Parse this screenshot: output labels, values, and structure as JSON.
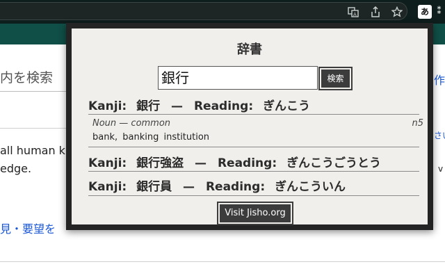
{
  "browser": {
    "icons": [
      "translate-icon",
      "share-icon",
      "bookmark-star-icon",
      "extension-icon"
    ],
    "extension_glyph": "あ"
  },
  "page": {
    "search_placeholder": "内を検索",
    "text_line1": "all human kn",
    "text_line2": "edge.",
    "link_text": "見・要望を",
    "right_frag_top": "作",
    "right_frag_mid": "さい",
    "right_frag_low": "v"
  },
  "popup": {
    "title": "辞書",
    "search_value": "銀行",
    "search_button": "検索",
    "kanji_label": "Kanji:",
    "reading_label": "Reading:",
    "dash": "—",
    "results": [
      {
        "kanji": "銀行",
        "reading": "ぎんこう"
      },
      {
        "kanji": "銀行強盗",
        "reading": "ぎんこうごうとう"
      },
      {
        "kanji": "銀行員",
        "reading": "ぎんこういん"
      }
    ],
    "detail": {
      "pos": "Noun — common",
      "jlpt": "n5",
      "meaning": "bank, banking institution"
    },
    "visit_button": "Visit Jisho.org"
  }
}
